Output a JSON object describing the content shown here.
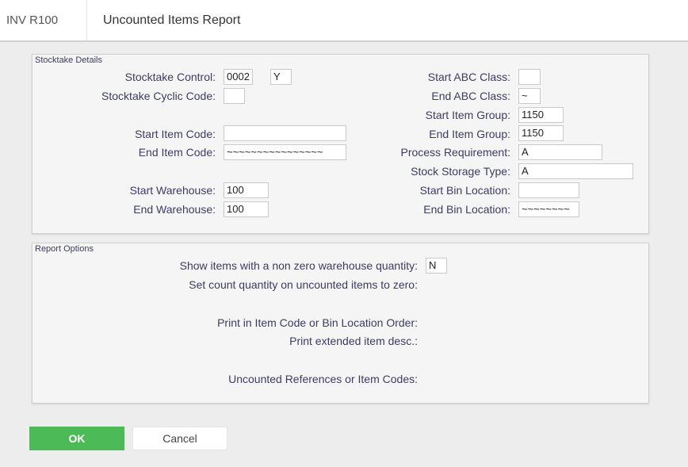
{
  "header": {
    "program_code": "INV R100",
    "title": "Uncounted Items Report"
  },
  "stocktake_details": {
    "title": "Stocktake Details",
    "stocktake_control_label": "Stocktake Control:",
    "stocktake_control_value": "0002",
    "stocktake_control_flag": "Y",
    "cyclic_code_label": "Stocktake Cyclic Code:",
    "cyclic_code_value": "",
    "start_item_code_label": "Start Item Code:",
    "start_item_code_value": "",
    "end_item_code_label": "End Item Code:",
    "end_item_code_value": "~~~~~~~~~~~~~~~~",
    "start_warehouse_label": "Start Warehouse:",
    "start_warehouse_value": "100",
    "end_warehouse_label": "End Warehouse:",
    "end_warehouse_value": "100",
    "start_abc_label": "Start ABC Class:",
    "start_abc_value": "",
    "end_abc_label": "End ABC Class:",
    "end_abc_value": "~",
    "start_item_group_label": "Start Item Group:",
    "start_item_group_value": "1150",
    "end_item_group_label": "End Item Group:",
    "end_item_group_value": "1150",
    "process_requirement_label": "Process Requirement:",
    "process_requirement_value": "A",
    "stock_storage_type_label": "Stock Storage Type:",
    "stock_storage_type_value": "A",
    "start_bin_label": "Start Bin Location:",
    "start_bin_value": "",
    "end_bin_label": "End Bin Location:",
    "end_bin_value": "~~~~~~~~"
  },
  "report_options": {
    "title": "Report Options",
    "non_zero_label": "Show items with a non zero warehouse quantity:",
    "non_zero_value": "N",
    "set_count_label": "Set count quantity on uncounted items to zero:",
    "print_order_label": "Print in Item Code or Bin Location Order:",
    "print_extended_label": "Print extended item desc.:",
    "uncounted_refs_label": "Uncounted References or Item Codes:"
  },
  "buttons": {
    "ok": "OK",
    "cancel": "Cancel"
  },
  "colors": {
    "ok_button": "#4cba57",
    "label_text": "#3c3c62",
    "page_background": "#ededed"
  }
}
